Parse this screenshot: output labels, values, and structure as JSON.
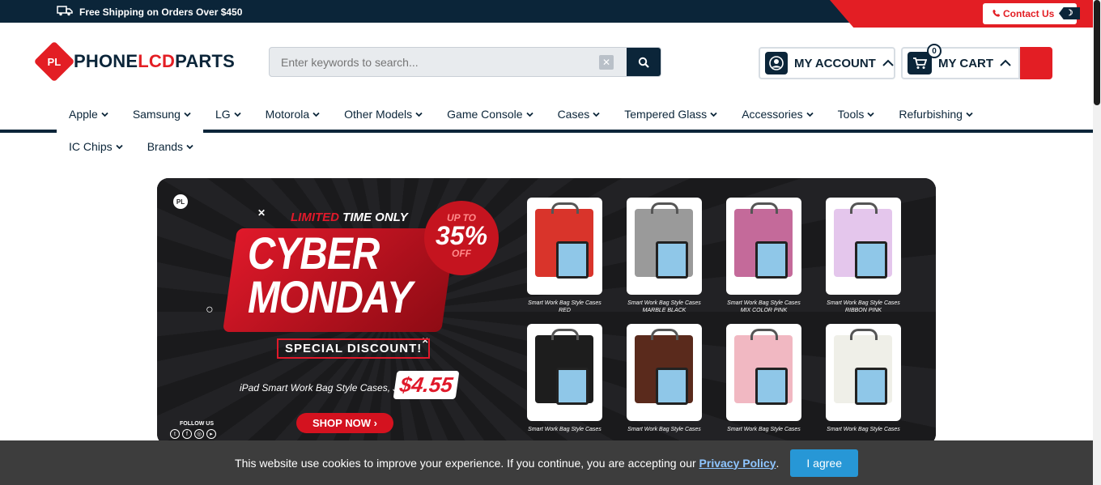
{
  "topbar": {
    "shipping": "Free Shipping on Orders Over $450",
    "contact": "Contact Us"
  },
  "logo": {
    "badge": "PL",
    "word_a": "PHONE",
    "word_b": "LCD",
    "word_c": "PARTS"
  },
  "search": {
    "placeholder": "Enter keywords to search..."
  },
  "account": {
    "label": "MY ACCOUNT"
  },
  "cart": {
    "label": "MY CART",
    "count": "0"
  },
  "nav": {
    "row1": [
      "Apple",
      "Samsung",
      "LG",
      "Motorola",
      "Other Models",
      "Game Console",
      "Cases",
      "Tempered Glass",
      "Accessories",
      "Tools",
      "Refurbishing"
    ],
    "row2": [
      "IC Chips",
      "Brands"
    ]
  },
  "banner": {
    "limited_a": "LIMITED",
    "limited_b": "TIME ONLY",
    "headline_1": "CYBER",
    "headline_2": "MONDAY",
    "up_to": "UP TO",
    "percent": "35%",
    "off": "OFF",
    "special": "SPECIAL DISCOUNT!",
    "just": "iPad Smart Work Bag Style Cases, Just",
    "price": "$4.55",
    "shop": "SHOP NOW",
    "follow": "FOLLOW US",
    "products": [
      {
        "title": "Smart Work Bag Style Cases",
        "variant": "RED",
        "color": "#d9342b"
      },
      {
        "title": "Smart Work Bag Style Cases",
        "variant": "MARBLE BLACK",
        "color": "#9a9a9a"
      },
      {
        "title": "Smart Work Bag Style Cases",
        "variant": "MIX COLOR PINK",
        "color": "#c46a9a"
      },
      {
        "title": "Smart Work Bag Style Cases",
        "variant": "RIBBON PINK",
        "color": "#e4c6ec"
      },
      {
        "title": "Smart Work Bag Style Cases",
        "variant": "",
        "color": "#1d1d1d"
      },
      {
        "title": "Smart Work Bag Style Cases",
        "variant": "",
        "color": "#5a2a1c"
      },
      {
        "title": "Smart Work Bag Style Cases",
        "variant": "",
        "color": "#f1b8c2"
      },
      {
        "title": "Smart Work Bag Style Cases",
        "variant": "",
        "color": "#efefe8"
      }
    ]
  },
  "cookie": {
    "message": "This website use cookies to improve your experience. If you continue, you are accepting our",
    "link": "Privacy Policy",
    "period": ".",
    "agree": "I agree"
  },
  "colors": {
    "navy": "#0b2539",
    "red": "#e31e24",
    "agree_blue": "#2797d6"
  }
}
